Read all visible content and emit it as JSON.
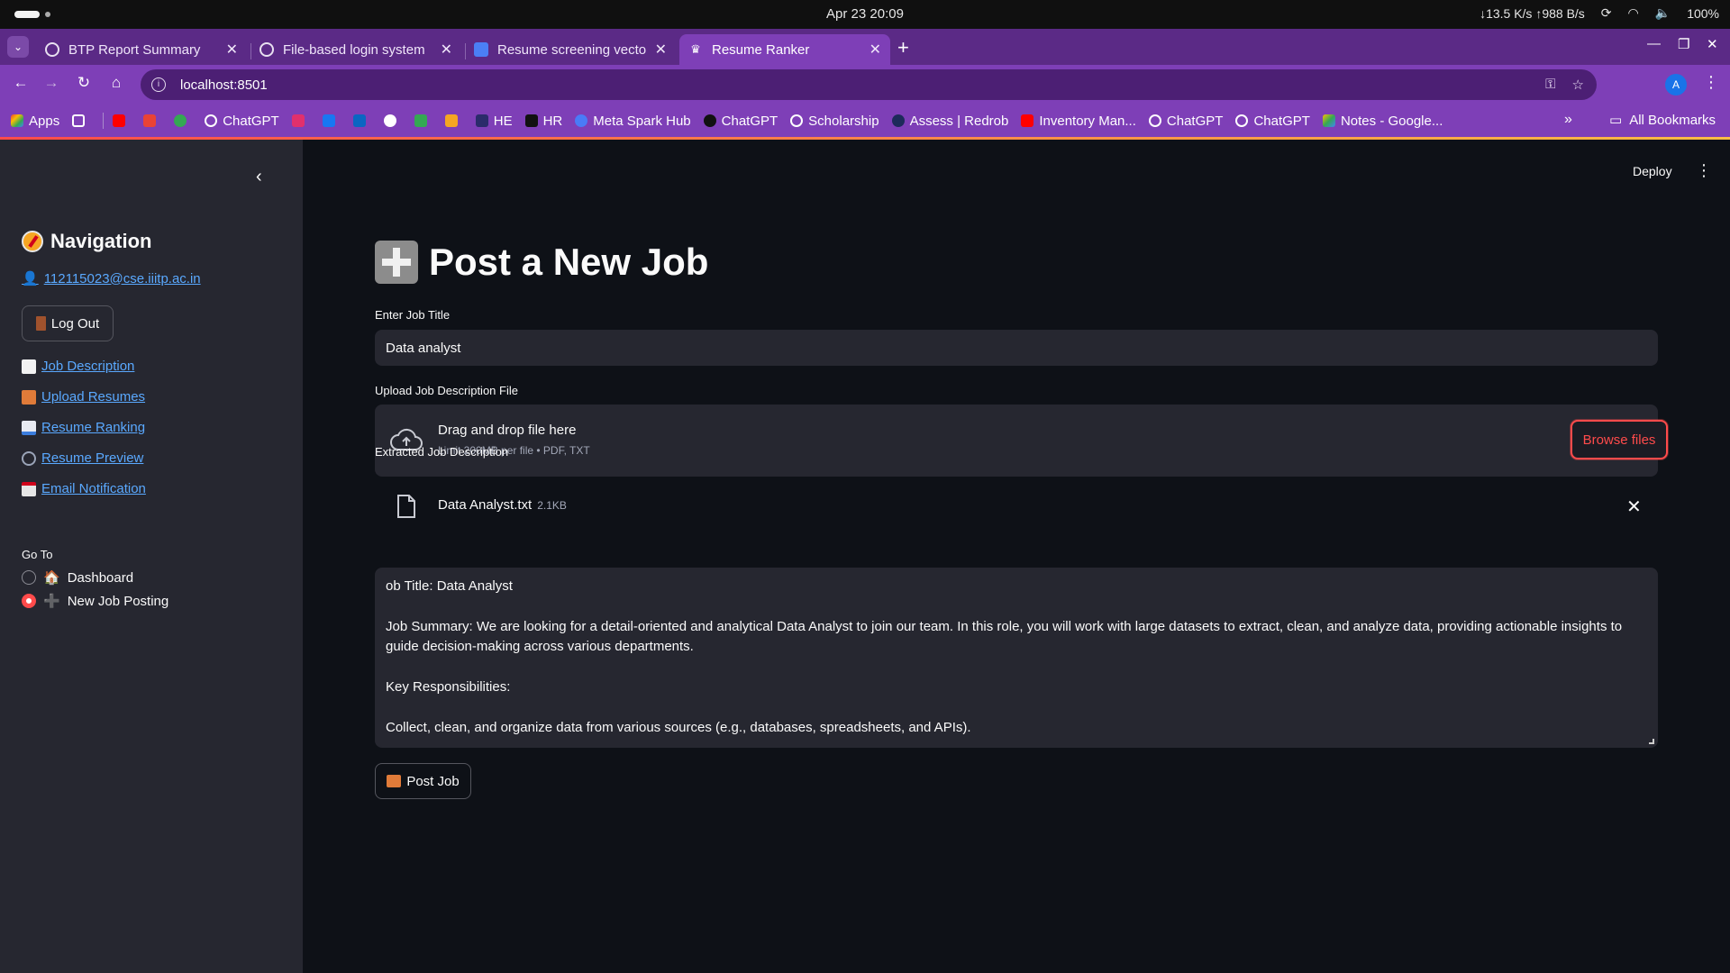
{
  "os": {
    "datetime": "Apr 23  20:09",
    "net_speed": "↓13.5 K/s ↑988 B/s",
    "battery": "100%"
  },
  "browser": {
    "tabs": [
      {
        "label": "BTP Report Summary",
        "active": false
      },
      {
        "label": "File-based login system",
        "active": false
      },
      {
        "label": "Resume screening vecto",
        "active": false
      },
      {
        "label": "Resume Ranker",
        "active": true
      }
    ],
    "url": "localhost:8501",
    "profile_initial": "A",
    "bookmarks": [
      "Apps",
      "ChatGPT",
      "HE",
      "HR",
      "Meta Spark Hub",
      "ChatGPT",
      "Scholarship",
      "Assess | Redrob",
      "Inventory Man...",
      "ChatGPT",
      "ChatGPT",
      "Notes - Google..."
    ],
    "all_bookmarks": "All Bookmarks"
  },
  "sidebar": {
    "title": "Navigation",
    "user_email": "112115023@cse.iiitp.ac.in",
    "logout_label": "Log Out",
    "links": [
      {
        "label": "Job Description"
      },
      {
        "label": "Upload Resumes"
      },
      {
        "label": "Resume Ranking"
      },
      {
        "label": "Resume Preview"
      },
      {
        "label": "Email Notification"
      }
    ],
    "goto_label": "Go To",
    "goto_options": [
      {
        "label": "Dashboard",
        "selected": false
      },
      {
        "label": "New Job Posting",
        "selected": true
      }
    ]
  },
  "header": {
    "deploy_label": "Deploy"
  },
  "main": {
    "title": "Post a New Job",
    "job_title_label": "Enter Job Title",
    "job_title_value": "Data analyst",
    "upload_label": "Upload Job Description File",
    "dropzone_title": "Drag and drop file here",
    "dropzone_sub": "Limit 200MB per file • PDF, TXT",
    "browse_label": "Browse files",
    "file_name": "Data Analyst.txt",
    "file_size": "2.1KB",
    "extracted_label": "Extracted Job Description",
    "extracted_lines": [
      "ob Title: Data Analyst",
      "",
      "Job Summary: We are looking for a detail-oriented and analytical Data Analyst to join our team. In this role, you will work with large datasets to extract, clean, and analyze data, providing actionable insights to guide decision-making across various departments.",
      "",
      "Key Responsibilities:",
      "",
      "Collect, clean, and organize data from various sources (e.g., databases, spreadsheets, and APIs)."
    ],
    "post_label": "Post Job"
  },
  "colors": {
    "accent": "#ff4b4b",
    "link": "#5aa9ff",
    "tabstrip": "#5b2a86",
    "toolbar": "#7e3fb7"
  }
}
